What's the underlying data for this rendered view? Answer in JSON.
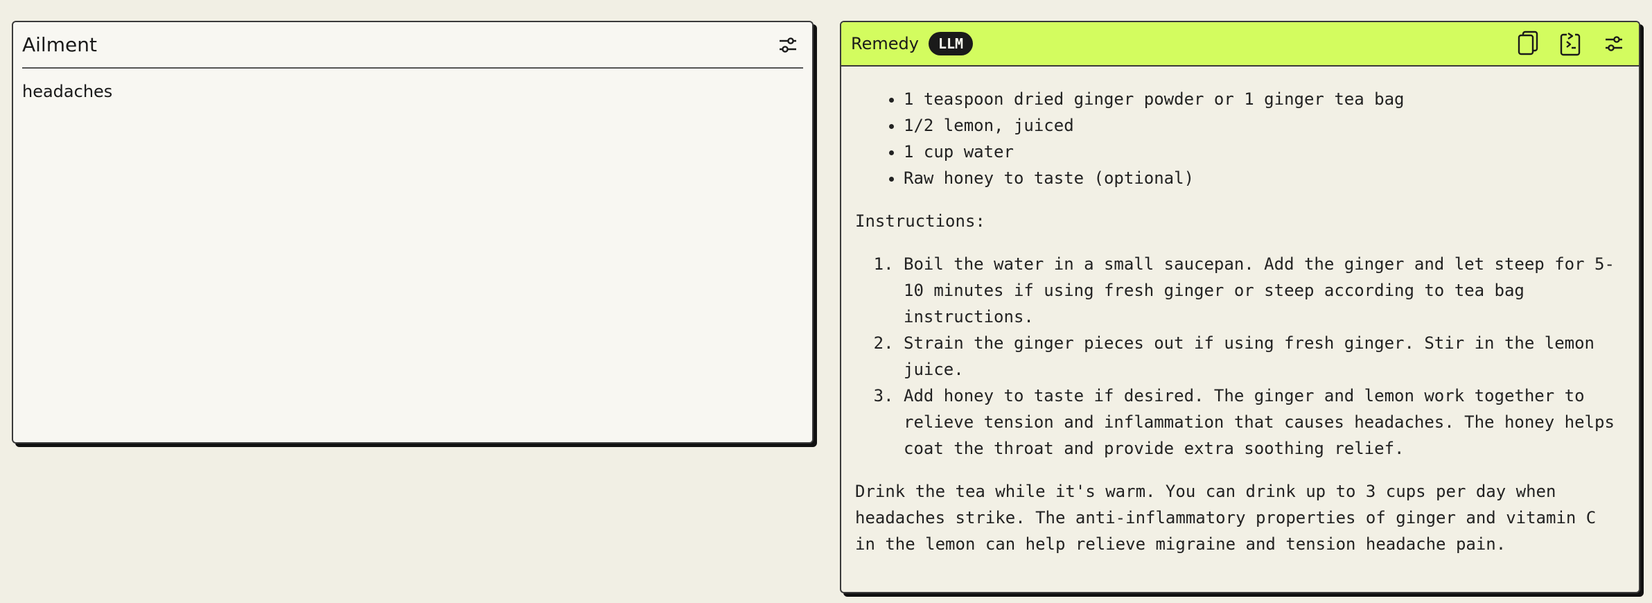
{
  "ailment": {
    "title": "Ailment",
    "value": "headaches",
    "settings_icon": "sliders-icon"
  },
  "remedy": {
    "title": "Remedy",
    "badge": "LLM",
    "header_color": "#d3fc5f",
    "icons": [
      "copy-icon",
      "copy-to-input-icon",
      "sliders-icon"
    ],
    "ingredients": [
      "1 teaspoon dried ginger powder or 1 ginger tea bag",
      "1/2 lemon, juiced",
      "1 cup water",
      "Raw honey to taste (optional)"
    ],
    "instructions_heading": "Instructions:",
    "steps": [
      "Boil the water in a small saucepan. Add the ginger and let steep for 5-10 minutes if using fresh ginger or steep according to tea bag instructions.",
      "Strain the ginger pieces out if using fresh ginger. Stir in the lemon juice.",
      "Add honey to taste if desired. The ginger and lemon work together to relieve tension and inflammation that causes headaches. The honey helps coat the throat and provide extra soothing relief."
    ],
    "closing": "Drink the tea while it's warm. You can drink up to 3 cups per day when headaches strike. The anti-inflammatory properties of ginger and vitamin C in the lemon can help relieve migraine and tension headache pain."
  }
}
